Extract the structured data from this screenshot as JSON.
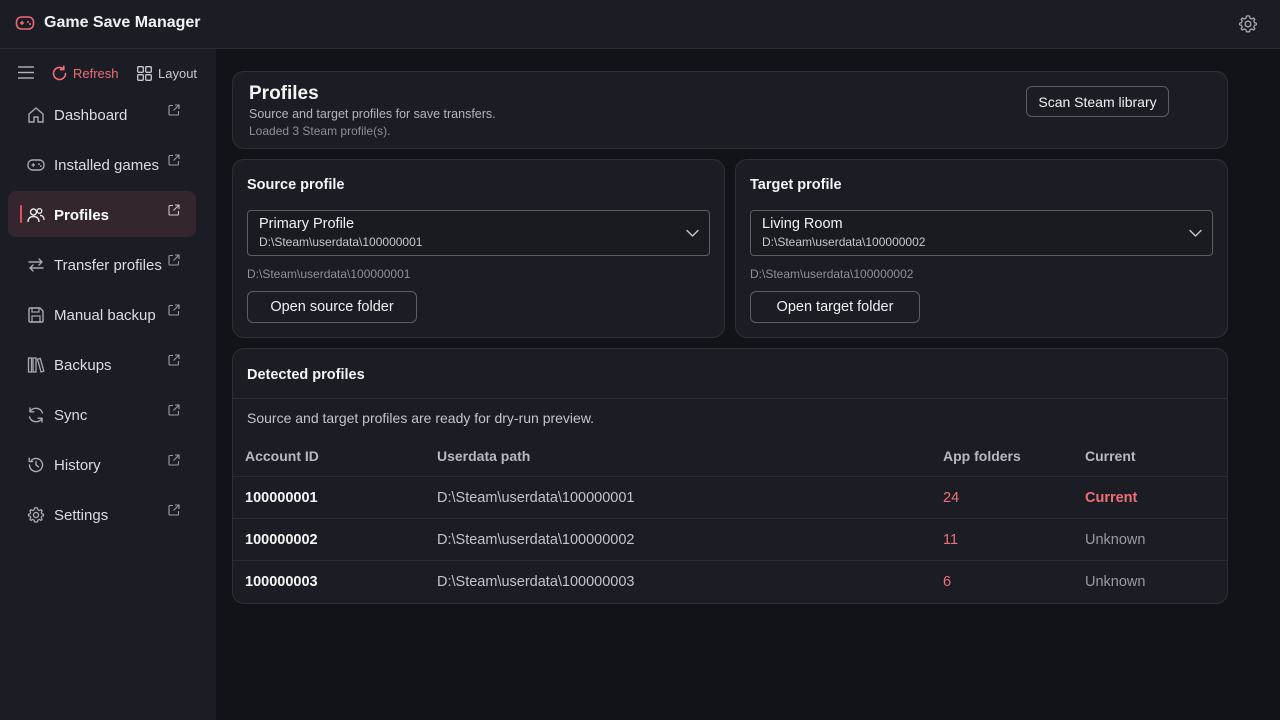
{
  "app": {
    "title": "Game Save Manager"
  },
  "colors": {
    "accent": "#e04f5f",
    "accent_text": "#ec6f7a",
    "background": "#121318",
    "panel": "#1c1d24"
  },
  "toolbar": {
    "refresh_label": "Refresh",
    "layout_label": "Layout"
  },
  "sidebar": {
    "items": [
      {
        "label": "Dashboard",
        "icon": "home-icon",
        "active": false
      },
      {
        "label": "Installed games",
        "icon": "gamepad-icon",
        "active": false
      },
      {
        "label": "Profiles",
        "icon": "users-icon",
        "active": true
      },
      {
        "label": "Transfer profiles",
        "icon": "transfer-icon",
        "active": false
      },
      {
        "label": "Manual backup",
        "icon": "save-icon",
        "active": false
      },
      {
        "label": "Backups",
        "icon": "library-icon",
        "active": false
      },
      {
        "label": "Sync",
        "icon": "sync-icon",
        "active": false
      },
      {
        "label": "History",
        "icon": "history-icon",
        "active": false
      },
      {
        "label": "Settings",
        "icon": "gear-icon",
        "active": false
      }
    ]
  },
  "header": {
    "title": "Profiles",
    "subtitle": "Source and target profiles for save transfers.",
    "status": "Loaded 3 Steam profile(s).",
    "scan_label": "Scan Steam library"
  },
  "source": {
    "title": "Source profile",
    "selected_name": "Primary Profile",
    "selected_path": "D:\\Steam\\userdata\\100000001",
    "path": "D:\\Steam\\userdata\\100000001",
    "open_label": "Open source folder"
  },
  "target": {
    "title": "Target profile",
    "selected_name": "Living Room",
    "selected_path": "D:\\Steam\\userdata\\100000002",
    "path": "D:\\Steam\\userdata\\100000002",
    "open_label": "Open target folder"
  },
  "detected": {
    "title": "Detected profiles",
    "status": "Source and target profiles are ready for dry-run preview.",
    "columns": [
      "Account ID",
      "Userdata path",
      "App folders",
      "Current"
    ],
    "rows": [
      {
        "account_id": "100000001",
        "path": "D:\\Steam\\userdata\\100000001",
        "app_folders": "24",
        "current": "Current"
      },
      {
        "account_id": "100000002",
        "path": "D:\\Steam\\userdata\\100000002",
        "app_folders": "11",
        "current": "Unknown"
      },
      {
        "account_id": "100000003",
        "path": "D:\\Steam\\userdata\\100000003",
        "app_folders": "6",
        "current": "Unknown"
      }
    ]
  }
}
